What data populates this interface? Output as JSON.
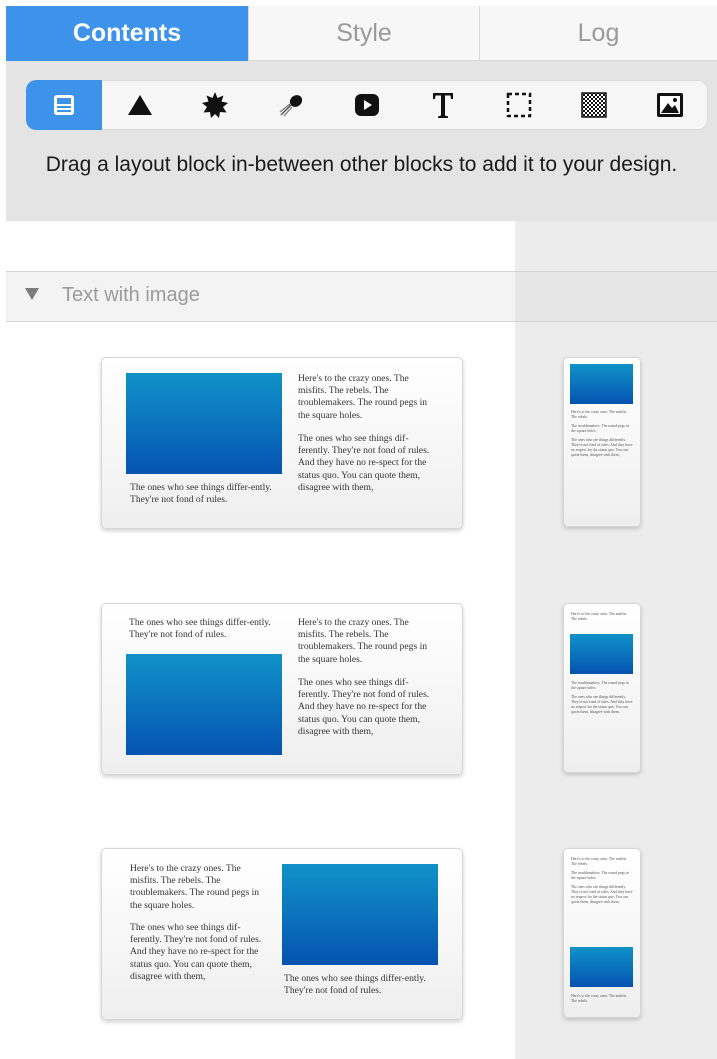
{
  "tabs": [
    {
      "label": "Contents",
      "active": true
    },
    {
      "label": "Style",
      "active": false
    },
    {
      "label": "Log",
      "active": false
    }
  ],
  "toolbar": {
    "icons": [
      "layout-block-icon",
      "shape-icon",
      "starburst-icon",
      "brush-icon",
      "video-icon",
      "text-icon",
      "selection-icon",
      "pattern-icon",
      "image-icon"
    ],
    "selected": "layout-block-icon",
    "accent": "#3d93ea"
  },
  "hint": "Drag a layout block in-between other blocks to add it to your design.",
  "section": {
    "title": "Text with image",
    "expanded": true
  },
  "sample_text": {
    "intro": "Here's to the crazy ones. The misfits. The rebels. The troublemakers. The round pegs in the square holes.",
    "body": "The ones who see things dif-ferently. They're not fond of rules. And they have no re-spect for the status quo. You can quote them, disagree with them,",
    "caption": "The ones who see things differ-ently. They're not fond of rules.",
    "small_intro": "Here's to the crazy ones. The misfits. The rebels.",
    "small_mid": "The troublemakers. The round pegs in the square holes.",
    "small_body": "The ones who see things differently. They're not fond of rules. And they have no respect for the status quo. You can quote them, disagree with them,"
  }
}
